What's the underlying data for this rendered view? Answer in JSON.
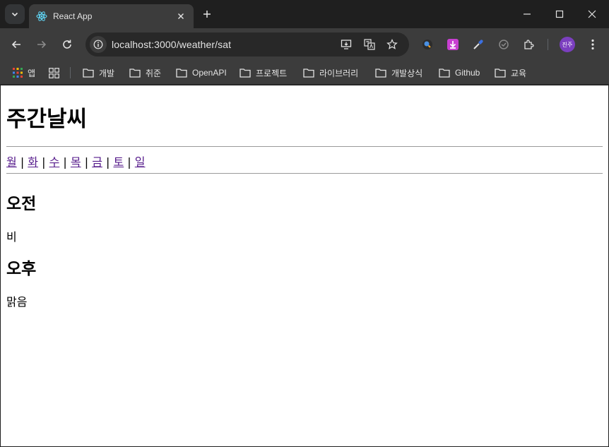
{
  "browser": {
    "tab_title": "React App",
    "url": "localhost:3000/weather/sat",
    "profile_label": "진주"
  },
  "bookmarks": [
    {
      "label": "앱"
    },
    {
      "label": "개발"
    },
    {
      "label": "취준"
    },
    {
      "label": "OpenAPI"
    },
    {
      "label": "프로젝트"
    },
    {
      "label": "라이브러리"
    },
    {
      "label": "개발상식"
    },
    {
      "label": "Github"
    },
    {
      "label": "교육"
    }
  ],
  "page": {
    "title": "주간날씨",
    "days": [
      "월",
      "화",
      "수",
      "목",
      "금",
      "토",
      "일"
    ],
    "separator": " | ",
    "morning_heading": "오전",
    "morning_weather": "비",
    "afternoon_heading": "오후",
    "afternoon_weather": "맑음"
  },
  "colors": {
    "chrome_dark": "#1f1f1f",
    "toolbar": "#3c3c3c",
    "visited_link": "#551a8b",
    "profile": "#7b3fbf"
  }
}
